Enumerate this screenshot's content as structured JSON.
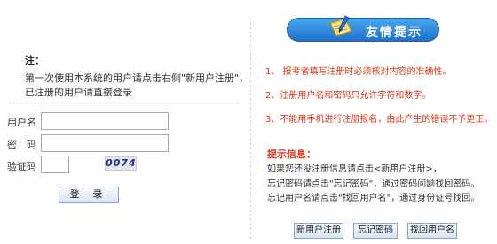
{
  "left": {
    "note_title": "注：",
    "note_line1": "第一次使用本系统的用户请点击右侧\"新用户注册\"，",
    "note_line2": "已注册的用户请直接登录",
    "username_label": "用户名",
    "username_value": "",
    "password_label": "密　码",
    "password_value": "",
    "captcha_label": "验证码",
    "captcha_value": "",
    "captcha_image_text": "0074",
    "login_label": "登 录"
  },
  "right": {
    "banner_title": "友情提示",
    "tips": [
      "1、 报考者填写注册时必须核对内容的准确性。",
      "2、注册用户名和密码只允许字符和数字。",
      "3、不能用手机进行注册报名，由此产生的错误不予更正。"
    ],
    "info_title": "提示信息：",
    "info_lines": [
      "如果您还没注册信息请点击<新用户注册>，",
      "忘记密码请点击\"忘记密码\"，通过密码问题找回密码。",
      "忘记用户名请点击\"找回用户名\"，通过身份证号找回。"
    ],
    "buttons": {
      "register": "新用户注册",
      "forgot_password": "忘记密码",
      "recover_username": "找回用户名"
    }
  },
  "colors": {
    "tip_red": "#e03418",
    "banner_blue": "#1f73cc"
  }
}
